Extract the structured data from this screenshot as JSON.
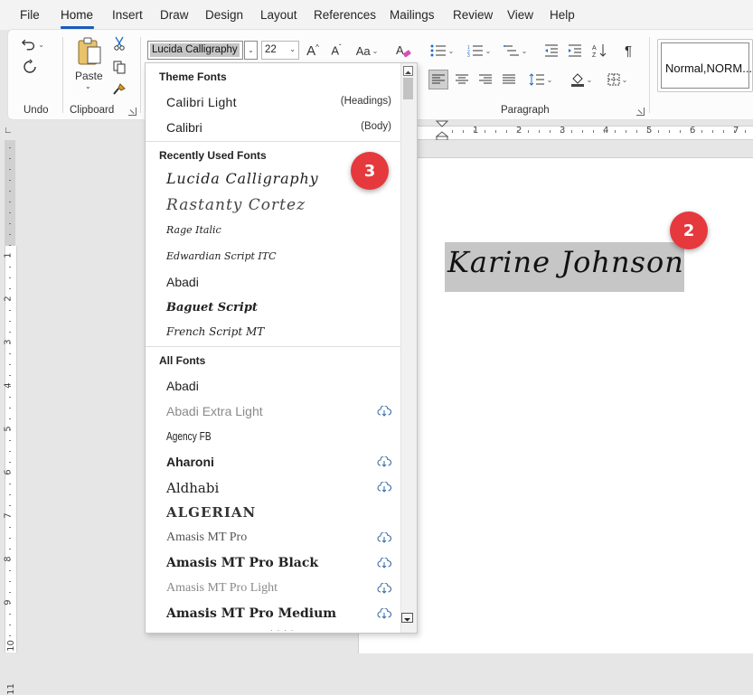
{
  "menu": {
    "tabs": [
      "File",
      "Home",
      "Insert",
      "Draw",
      "Design",
      "Layout",
      "References",
      "Mailings",
      "Review",
      "View",
      "Help"
    ],
    "active": "Home"
  },
  "ribbon": {
    "undo_group_label": "Undo",
    "clipboard_group_label": "Clipboard",
    "paste_label": "Paste",
    "font_name": "Lucida Calligraphy",
    "font_size": "22",
    "paragraph_group_label": "Paragraph",
    "style_preview": "Normal,NORM..."
  },
  "ruler": {
    "horizontal_numbers": [
      "1",
      "2",
      "3",
      "4",
      "5",
      "6",
      "7"
    ],
    "vertical_numbers": [
      "1",
      "2",
      "3",
      "4",
      "5",
      "6",
      "7",
      "8",
      "9",
      "10",
      "11"
    ]
  },
  "document": {
    "text": "Karine Johnson"
  },
  "callouts": {
    "doc": "2",
    "dropdown": "3"
  },
  "font_dropdown": {
    "theme_header": "Theme Fonts",
    "theme_fonts": [
      {
        "name": "Calibri Light",
        "tag": "(Headings)"
      },
      {
        "name": "Calibri",
        "tag": "(Body)"
      }
    ],
    "recent_header": "Recently Used Fonts",
    "recent_fonts": [
      "Lucida Calligraphy",
      "Rastanty Cortez",
      "Rage Italic",
      "Edwardian Script ITC",
      "Abadi",
      "Baguet Script",
      "French Script MT"
    ],
    "all_header": "All Fonts",
    "all_fonts": [
      {
        "name": "Abadi",
        "cloud": false
      },
      {
        "name": "Abadi Extra Light",
        "cloud": true
      },
      {
        "name": "Agency FB",
        "cloud": false
      },
      {
        "name": "Aharoni",
        "cloud": true
      },
      {
        "name": "Aldhabi",
        "cloud": true
      },
      {
        "name": "ALGERIAN",
        "cloud": false
      },
      {
        "name": "Amasis MT Pro",
        "cloud": true
      },
      {
        "name": "Amasis MT Pro Black",
        "cloud": true
      },
      {
        "name": "Amasis MT Pro Light",
        "cloud": true
      },
      {
        "name": "Amasis MT Pro Medium",
        "cloud": true
      }
    ]
  },
  "colors": {
    "accent": "#185abd",
    "callout": "#e5393d",
    "selection": "#c6c6c6"
  }
}
